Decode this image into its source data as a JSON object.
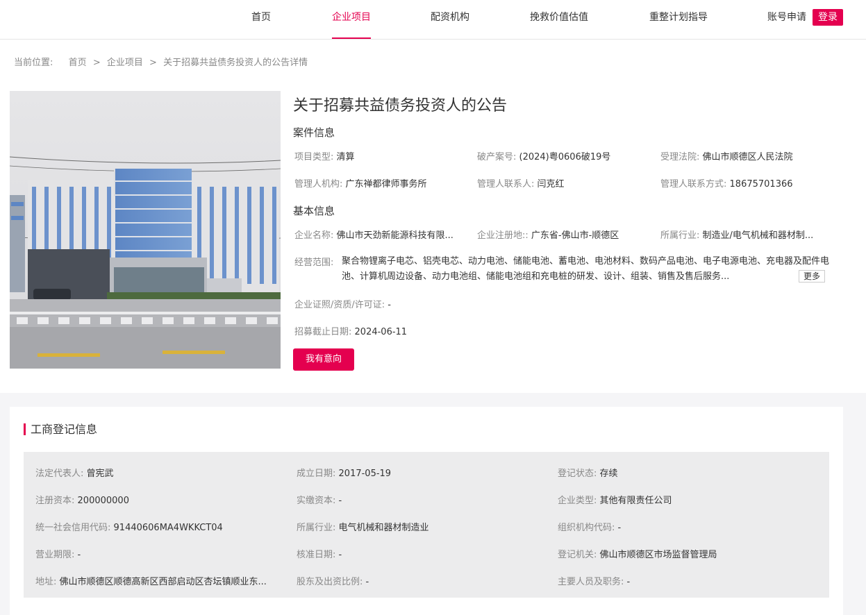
{
  "nav": {
    "home": "首页",
    "projects": "企业项目",
    "funding": "配资机构",
    "rescue": "挽救价值估值",
    "reorg": "重整计划指导",
    "account_apply": "账号申请",
    "login": "登录"
  },
  "breadcrumb": {
    "label": "当前位置:",
    "items": [
      "首页",
      "企业项目",
      "关于招募共益债务投资人的公告详情"
    ]
  },
  "project": {
    "title": "关于招募共益债务投资人的公告",
    "case_heading": "案件信息",
    "case": {
      "type_label": "项目类型:",
      "type": "清算",
      "case_no_label": "破产案号:",
      "case_no": "(2024)粤0606破19号",
      "court_label": "受理法院:",
      "court": "佛山市顺德区人民法院",
      "admin_org_label": "管理人机构:",
      "admin_org": "广东禅都律师事务所",
      "contact_label": "管理人联系人:",
      "contact": "闫克红",
      "phone_label": "管理人联系方式:",
      "phone": "18675701366"
    },
    "basic_heading": "基本信息",
    "basic": {
      "company_label": "企业名称:",
      "company": "佛山市天劲新能源科技有限...",
      "reg_place_label": "企业注册地::",
      "reg_place": "广东省-佛山市-顺德区",
      "industry_label": "所属行业:",
      "industry": "制造业/电气机械和器材制...",
      "scope_label": "经营范围:",
      "scope": "聚合物锂离子电芯、铝壳电芯、动力电池、储能电池、蓄电池、电池材料、数码产品电池、电子电源电池、充电器及配件电池、计算机周边设备、动力电池组、储能电池组和充电桩的研发、设计、组装、销售及售后服务...",
      "more": "更多",
      "license_label": "企业证照/资质/许可证:",
      "license": "-",
      "deadline_label": "招募截止日期:",
      "deadline": "2024-06-11"
    },
    "intent_button": "我有意向"
  },
  "registration": {
    "title": "工商登记信息",
    "rows": [
      [
        {
          "k": "法定代表人:",
          "v": "曾宪武"
        },
        {
          "k": "成立日期:",
          "v": "2017-05-19"
        },
        {
          "k": "登记状态:",
          "v": "存续"
        }
      ],
      [
        {
          "k": "注册资本:",
          "v": "200000000"
        },
        {
          "k": "实缴资本:",
          "v": "-"
        },
        {
          "k": "企业类型:",
          "v": "其他有限责任公司"
        }
      ],
      [
        {
          "k": "统一社会信用代码:",
          "v": "91440606MA4WKKCT04"
        },
        {
          "k": "所属行业:",
          "v": "电气机械和器材制造业"
        },
        {
          "k": "组织机构代码:",
          "v": "-"
        }
      ],
      [
        {
          "k": "营业期限:",
          "v": "-"
        },
        {
          "k": "核准日期:",
          "v": "-"
        },
        {
          "k": "登记机关:",
          "v": "佛山市顺德区市场监督管理局"
        }
      ],
      [
        {
          "k": "地址:",
          "v": "佛山市顺德区顺德高新区西部启动区杏坛镇顺业东..."
        },
        {
          "k": "股东及出资比例:",
          "v": "-"
        },
        {
          "k": "主要人员及职务:",
          "v": "-"
        }
      ]
    ]
  },
  "colors": {
    "accent": "#e4004f",
    "muted_text": "#888888",
    "body_text": "#333333",
    "panel_bg": "#ececed"
  }
}
